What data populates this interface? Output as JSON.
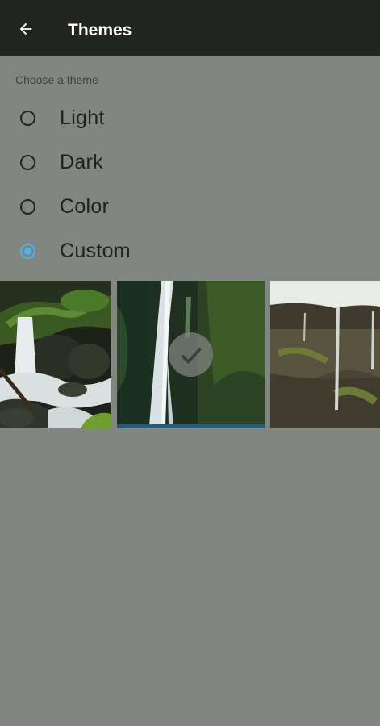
{
  "appbar": {
    "title": "Themes",
    "back_icon": "arrow-left-icon"
  },
  "section": {
    "label": "Choose a theme"
  },
  "theme_options": [
    {
      "label": "Light",
      "selected": false
    },
    {
      "label": "Dark",
      "selected": false
    },
    {
      "label": "Color",
      "selected": false
    },
    {
      "label": "Custom",
      "selected": true
    }
  ],
  "gallery": {
    "images": [
      {
        "subject": "mossy-stream-cascade",
        "selected": false
      },
      {
        "subject": "tall-waterfall",
        "selected": true
      },
      {
        "subject": "cliff-waterfalls",
        "selected": false
      }
    ],
    "selected_icon": "checkmark-icon"
  },
  "colors": {
    "appbar_bg": "#222520",
    "page_bg": "#818780",
    "accent": "#4fb0ec"
  }
}
